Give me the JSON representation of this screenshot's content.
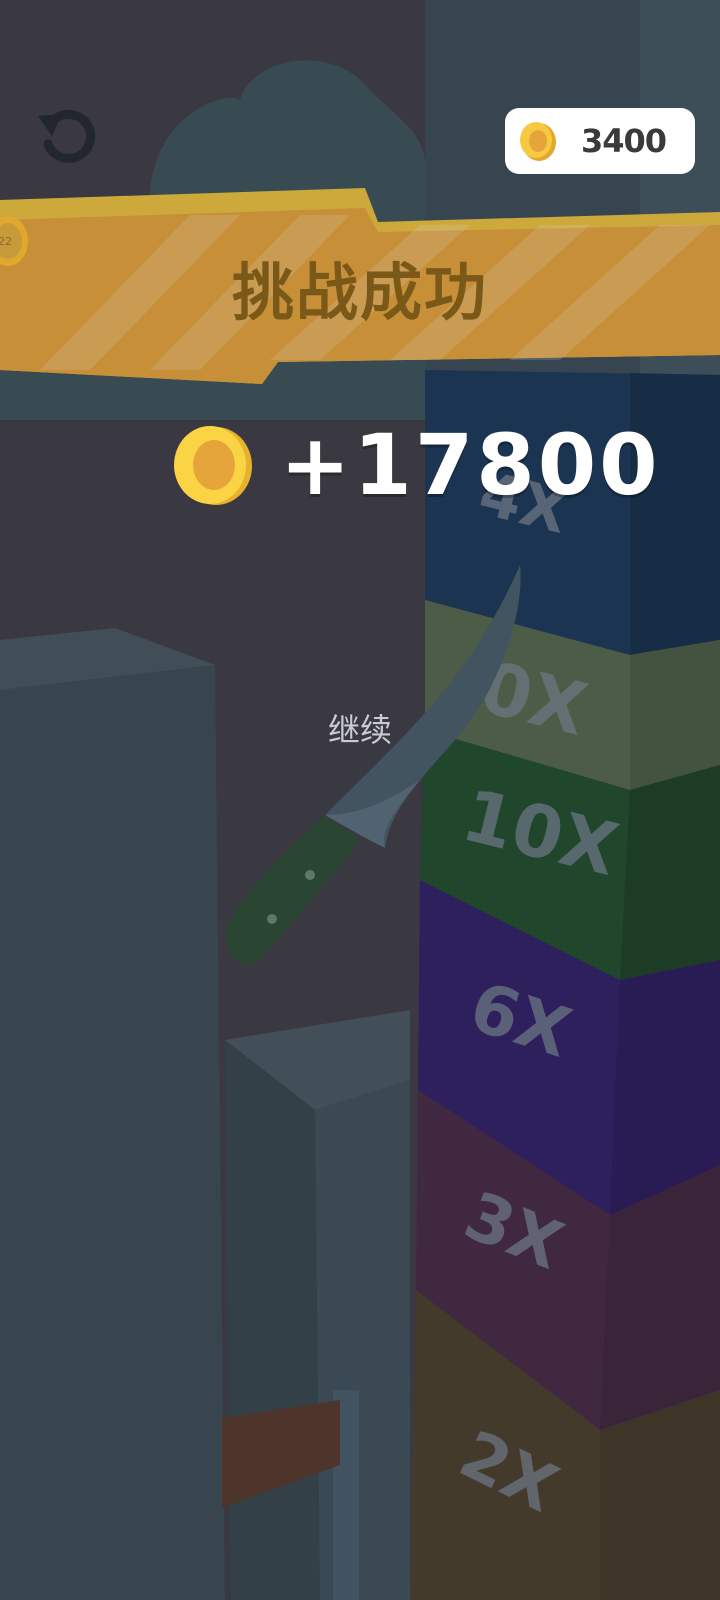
{
  "hud": {
    "restart_icon": "restart-arrow-icon",
    "coin_icon": "gold-coin-icon",
    "coin_balance": "3400"
  },
  "banner": {
    "title": "挑战成功",
    "level_badge_icon": "level-coin-icon",
    "level_badge_text": "22"
  },
  "reward": {
    "coin_icon": "gold-coin-icon",
    "amount": "+17800"
  },
  "continue_label": "继续",
  "tower": {
    "multipliers": [
      "4X",
      "0X",
      "10X",
      "6X",
      "3X",
      "2X"
    ]
  },
  "colors": {
    "banner_yellow": "#f5c842",
    "banner_orange": "#eda93c",
    "coin_gold": "#f7c940",
    "block_navy": "#1d3d60",
    "block_olive": "#566a4e",
    "block_green": "#22502f",
    "block_purple": "#33206b",
    "block_maroon": "#482b49",
    "block_brown": "#4e412f",
    "knife_blade": "#4c6170",
    "knife_handle": "#2e4f36"
  }
}
